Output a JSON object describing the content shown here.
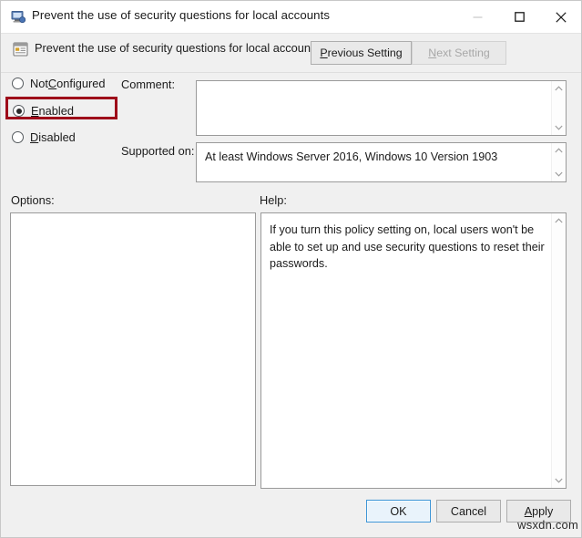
{
  "window": {
    "title": "Prevent the use of security questions for local accounts",
    "icon": "policy-window-icon",
    "controls": {
      "minimize": "minimize-icon",
      "maximize": "maximize-icon",
      "close": "close-icon"
    }
  },
  "header": {
    "icon": "policy-setting-icon",
    "policy_title": "Prevent the use of security questions for local accounts",
    "previous_setting": {
      "before": "",
      "accel": "P",
      "after": "revious Setting"
    },
    "next_setting": {
      "before": "",
      "accel": "N",
      "after": "ext Setting"
    }
  },
  "state_options": [
    {
      "id": "not-configured",
      "before": "Not ",
      "accel": "C",
      "after": "onfigured",
      "selected": false
    },
    {
      "id": "enabled",
      "before": "",
      "accel": "E",
      "after": "nabled",
      "selected": true
    },
    {
      "id": "disabled",
      "before": "",
      "accel": "D",
      "after": "isabled",
      "selected": false
    }
  ],
  "fields": {
    "comment_label": "Comment:",
    "comment_value": "",
    "supported_on_label": "Supported on:",
    "supported_on_value": "At least Windows Server 2016, Windows 10 Version 1903",
    "options_label": "Options:",
    "options_value": "",
    "help_label": "Help:",
    "help_value": "If you turn this policy setting on, local users won't be able to set up and use security questions to reset their passwords."
  },
  "buttons": {
    "ok": "OK",
    "cancel": "Cancel",
    "apply": {
      "before": "",
      "accel": "A",
      "after": "pply"
    }
  },
  "watermark": "wsxdn.com",
  "colors": {
    "highlight_red": "#9e0b1a",
    "focus_blue": "#3d95d6",
    "dialog_bg": "#f0f0f0"
  }
}
